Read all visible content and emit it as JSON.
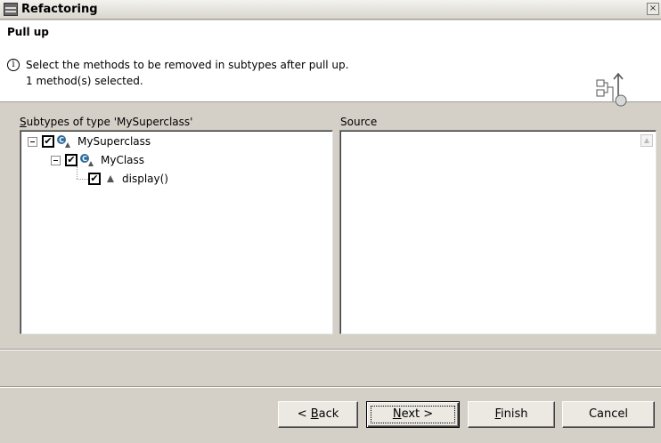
{
  "window": {
    "title": "Refactoring",
    "close_glyph": "×"
  },
  "banner": {
    "title": "Pull up",
    "info_glyph": "i",
    "message_line1": "Select the methods to be removed in subtypes after pull up.",
    "message_line2": "1 method(s) selected.",
    "icon": "pull-up-wizard-icon"
  },
  "subtypes": {
    "label_accel": "S",
    "label_rest": "ubtypes of type 'MySuperclass'",
    "tree": [
      {
        "label": "MySuperclass",
        "checked": "✔",
        "icon": "class-icon"
      },
      {
        "label": "MyClass",
        "checked": "✔",
        "icon": "class-icon"
      },
      {
        "label": "display()",
        "checked": "✔",
        "icon": "method-triangle-icon"
      }
    ]
  },
  "source": {
    "label": "Source",
    "scroll_glyph": "▲"
  },
  "buttons": {
    "back_pre": "< ",
    "back_accel": "B",
    "back_rest": "ack",
    "next_accel": "N",
    "next_rest": "ext >",
    "finish_accel": "F",
    "finish_rest": "inish",
    "cancel": "Cancel"
  },
  "colors": {
    "dialog_bg": "#d4d0c8",
    "banner_bg": "#ffffff",
    "class_icon": "#2f6d9c"
  }
}
